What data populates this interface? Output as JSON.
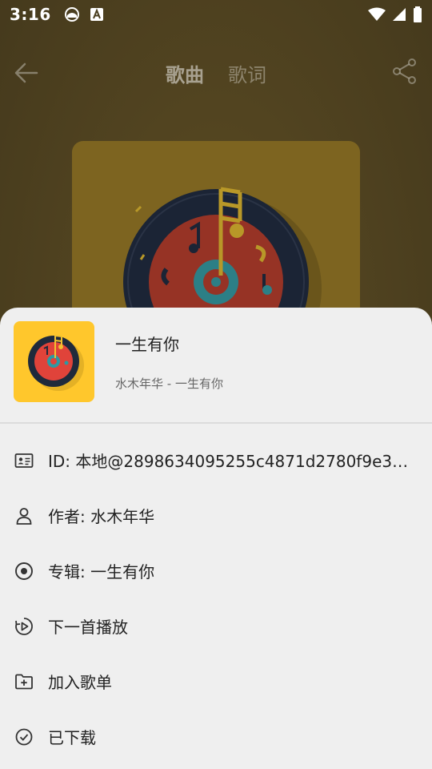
{
  "status_bar": {
    "time": "3:16"
  },
  "header": {
    "tabs": [
      {
        "label": "歌曲"
      },
      {
        "label": "歌词"
      }
    ]
  },
  "colors": {
    "cover_bg": "#ffc72c",
    "backdrop": "#4d401f",
    "sheet_bg": "#efefef"
  },
  "song": {
    "title": "一生有你",
    "subtitle": "水木年华 - 一生有你"
  },
  "menu": [
    {
      "icon": "id-card-icon",
      "label": "ID: 本地@2898634095255c4871d2780f9e3e93..."
    },
    {
      "icon": "person-icon",
      "label": "作者: 水木年华"
    },
    {
      "icon": "album-disc-icon",
      "label": "专辑: 一生有你"
    },
    {
      "icon": "play-next-icon",
      "label": "下一首播放"
    },
    {
      "icon": "add-folder-icon",
      "label": "加入歌单"
    },
    {
      "icon": "downloaded-check-icon",
      "label": "已下载"
    }
  ]
}
